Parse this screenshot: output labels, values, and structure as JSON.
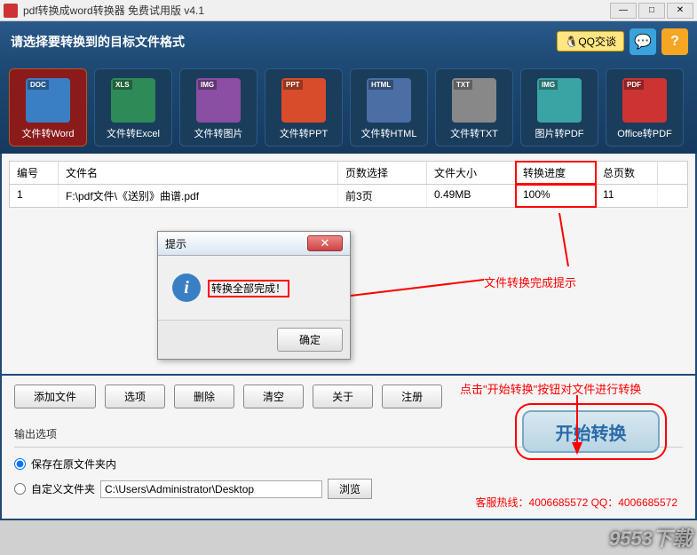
{
  "titlebar": {
    "text": "pdf转换成word转换器 免费试用版 v4.1"
  },
  "header": {
    "prompt": "请选择要转换到的目标文件格式",
    "qq": "QQ交谈"
  },
  "formats": [
    {
      "tag": "DOC",
      "label": "文件转Word",
      "color": "#3a7fc4"
    },
    {
      "tag": "XLS",
      "label": "文件转Excel",
      "color": "#2e8b57"
    },
    {
      "tag": "IMG",
      "label": "文件转图片",
      "color": "#8a4fa3"
    },
    {
      "tag": "PPT",
      "label": "文件转PPT",
      "color": "#d84c2b"
    },
    {
      "tag": "HTML",
      "label": "文件转HTML",
      "color": "#4a6fa5"
    },
    {
      "tag": "TXT",
      "label": "文件转TXT",
      "color": "#888"
    },
    {
      "tag": "IMG",
      "label": "图片转PDF",
      "color": "#3aa3a3"
    },
    {
      "tag": "PDF",
      "label": "Office转PDF",
      "color": "#c33"
    }
  ],
  "table": {
    "headers": {
      "id": "编号",
      "name": "文件名",
      "pages": "页数选择",
      "size": "文件大小",
      "progress": "转换进度",
      "total": "总页数"
    },
    "row": {
      "id": "1",
      "name": "F:\\pdf文件\\《送别》曲谱.pdf",
      "pages": "前3页",
      "size": "0.49MB",
      "progress": "100%",
      "total": "11"
    }
  },
  "dialog": {
    "title": "提示",
    "message": "转换全部完成！",
    "ok": "确定"
  },
  "annotations": {
    "done": "文件转换完成提示",
    "start": "点击\"开始转换\"按钮对文件进行转换"
  },
  "buttons": {
    "add": "添加文件",
    "options": "选项",
    "delete": "删除",
    "clear": "清空",
    "about": "关于",
    "register": "注册"
  },
  "output": {
    "label": "输出选项",
    "radio1": "保存在原文件夹内",
    "radio2": "自定义文件夹",
    "path": "C:\\Users\\Administrator\\Desktop",
    "browse": "浏览",
    "start": "开始转换",
    "hotline": "客服热线：4006685572 QQ：4006685572"
  },
  "watermark": "9553下载"
}
